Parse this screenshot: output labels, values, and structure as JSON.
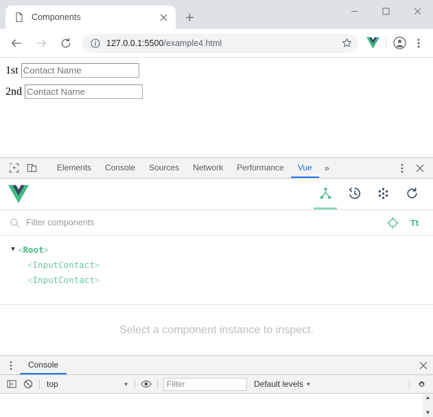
{
  "browser": {
    "tab": {
      "title": "Components",
      "favicon_icon": "page-icon",
      "close_icon": "close-icon"
    },
    "new_tab_label": "+",
    "window_controls": {
      "minimize": "minimize-icon",
      "maximize": "maximize-icon",
      "close": "close-icon"
    },
    "toolbar": {
      "back_icon": "back-arrow-icon",
      "forward_icon": "forward-arrow-icon",
      "reload_icon": "reload-icon",
      "site_info_icon": "info-circle-icon",
      "url_host": "127.0.0.1:5500",
      "url_path": "/example4.html",
      "bookmark_icon": "star-icon",
      "extension_icon": "vue-extension-icon",
      "profile_icon": "account-icon",
      "menu_icon": "kebab-menu-icon"
    }
  },
  "page": {
    "rows": [
      {
        "label": "1st",
        "placeholder": "Contact Name",
        "value": ""
      },
      {
        "label": "2nd",
        "placeholder": "Contact Name",
        "value": ""
      }
    ]
  },
  "devtools": {
    "inspect_icon": "inspect-cursor-icon",
    "device_toolbar_icon": "device-toggle-icon",
    "tabs": [
      {
        "label": "Elements",
        "active": false
      },
      {
        "label": "Console",
        "active": false
      },
      {
        "label": "Sources",
        "active": false
      },
      {
        "label": "Network",
        "active": false
      },
      {
        "label": "Performance",
        "active": false
      },
      {
        "label": "Vue",
        "active": true
      }
    ],
    "overflow_label": "»",
    "settings_icon": "kebab-menu-icon",
    "close_icon": "close-icon",
    "active_tab": "Vue",
    "accent_color": "#1a73e8"
  },
  "vue_panel": {
    "logo_icon": "vue-logo-icon",
    "brand_color": "#42b983",
    "tab_icons": [
      {
        "name": "components-tree-icon",
        "active": true
      },
      {
        "name": "timeline-history-icon",
        "active": false
      },
      {
        "name": "vuex-dots-icon",
        "active": false
      },
      {
        "name": "refresh-icon",
        "active": false
      }
    ],
    "filter": {
      "search_icon": "search-icon",
      "placeholder": "Filter components",
      "value": "",
      "select_component_icon": "target-select-icon",
      "text_size_icon": "Tt"
    },
    "tree": [
      {
        "name": "Root",
        "depth": 0,
        "expanded": true,
        "arrow": "▼"
      },
      {
        "name": "InputContact",
        "depth": 1,
        "expanded": false,
        "arrow": ""
      },
      {
        "name": "InputContact",
        "depth": 1,
        "expanded": false,
        "arrow": ""
      }
    ],
    "bracket_open": "<",
    "bracket_close": ">",
    "inspector_empty_message": "Select a component instance to inspect."
  },
  "console_drawer": {
    "kebab_icon": "kebab-menu-icon",
    "tab_label": "Console",
    "close_icon": "close-icon",
    "toolbar": {
      "sidebar_icon": "console-sidebar-icon",
      "clear_icon": "clear-console-icon",
      "context_value": "top",
      "context_caret": "▾",
      "eye_icon": "live-expression-icon",
      "filter_placeholder": "Filter",
      "filter_value": "",
      "levels_label": "Default levels",
      "levels_caret": "▾",
      "settings_icon": "gear-icon"
    },
    "scrollbar": {
      "up": "▲",
      "down": "▼"
    }
  }
}
